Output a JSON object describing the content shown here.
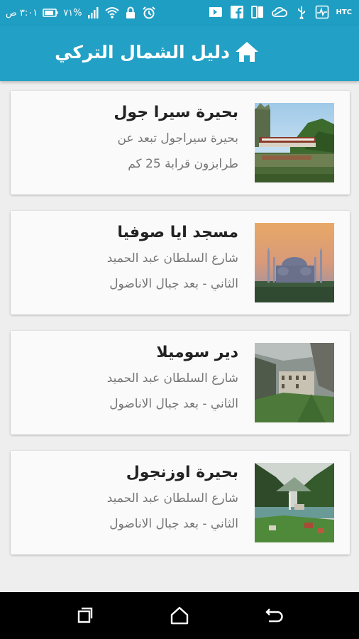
{
  "status_bar": {
    "time": "٣:٠١ ص",
    "battery": "٧١%",
    "carrier_badge": "HTC",
    "icons": [
      "battery-icon",
      "signal-icon",
      "wifi-icon",
      "lock-icon",
      "alarm-icon",
      "htc-icon",
      "pulse-icon",
      "usb-icon",
      "cloud-sync-icon",
      "dual-sim-icon",
      "facebook-icon",
      "play-store-icon"
    ]
  },
  "app_bar": {
    "title": "دليل الشمال التركي",
    "icon": "home-icon"
  },
  "places": [
    {
      "name": "بحيرة سيرا جول",
      "desc_line1": "بحيرة سيراجول تبعد عن",
      "desc_line2": "طرابزون قرابة 25 كم",
      "image": "lake-village-photo"
    },
    {
      "name": "مسجد ايا صوفيا",
      "desc_line1": "شارع السلطان عبد الحميد",
      "desc_line2": "الثاني - بعد جبال الاناضول",
      "image": "hagia-sophia-photo"
    },
    {
      "name": "دير سوميلا",
      "desc_line1": "شارع السلطان عبد الحميد",
      "desc_line2": "الثاني - بعد جبال الاناضول",
      "image": "sumela-monastery-photo"
    },
    {
      "name": "بحيرة اوزنجول",
      "desc_line1": "شارع السلطان عبد الحميد",
      "desc_line2": "الثاني - بعد جبال الاناضول",
      "image": "uzungol-lake-photo"
    }
  ],
  "nav_bar": {
    "buttons": [
      "recents-icon",
      "home-nav-icon",
      "back-icon"
    ]
  },
  "colors": {
    "primary": "#22a0c6",
    "status_bar": "#1f9ec3",
    "background": "#eeeeee",
    "card": "#fafafa"
  }
}
